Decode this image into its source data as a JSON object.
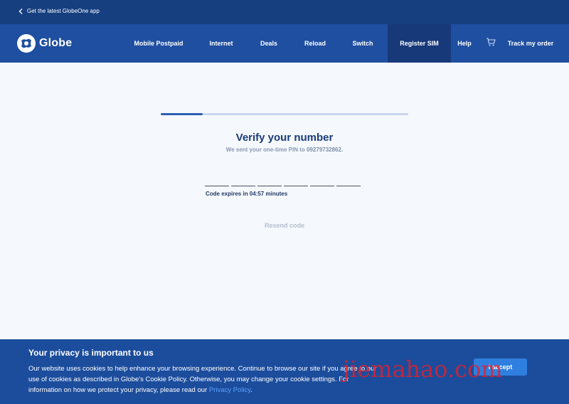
{
  "topbar": {
    "app_link": "Get the latest GlobeOne app"
  },
  "nav": {
    "logo": "Globe",
    "items": [
      "Mobile Postpaid",
      "Internet",
      "Deals",
      "Reload",
      "Switch",
      "Register SIM",
      "Help"
    ],
    "active": "Register SIM",
    "track_order": "Track my order"
  },
  "verify": {
    "progress": 0.17,
    "title": "Verify your number",
    "subtitle_prefix": "We sent your one-time PIN to",
    "phone": "09279732862.",
    "otp_length": 6,
    "expiry": "Code expires in 04:57 minutes",
    "resend": "Resend code"
  },
  "cookie": {
    "title": "Your privacy is important to us",
    "body": "Our website uses cookies to help enhance your browsing experience. Continue to browse our site if you agree to our use of cookies as described in Globe's Cookie Policy. Otherwise, you may change your cookie settings. For information on how we protect your privacy, please read our",
    "link": "Privacy Policy",
    "end": ".",
    "accept": "I accept"
  },
  "watermark": "jiemahao.com",
  "colors": {
    "topbar": "#163f80",
    "nav": "#1f4fa0",
    "accent": "#2f7fe0",
    "title": "#1a3c78"
  }
}
